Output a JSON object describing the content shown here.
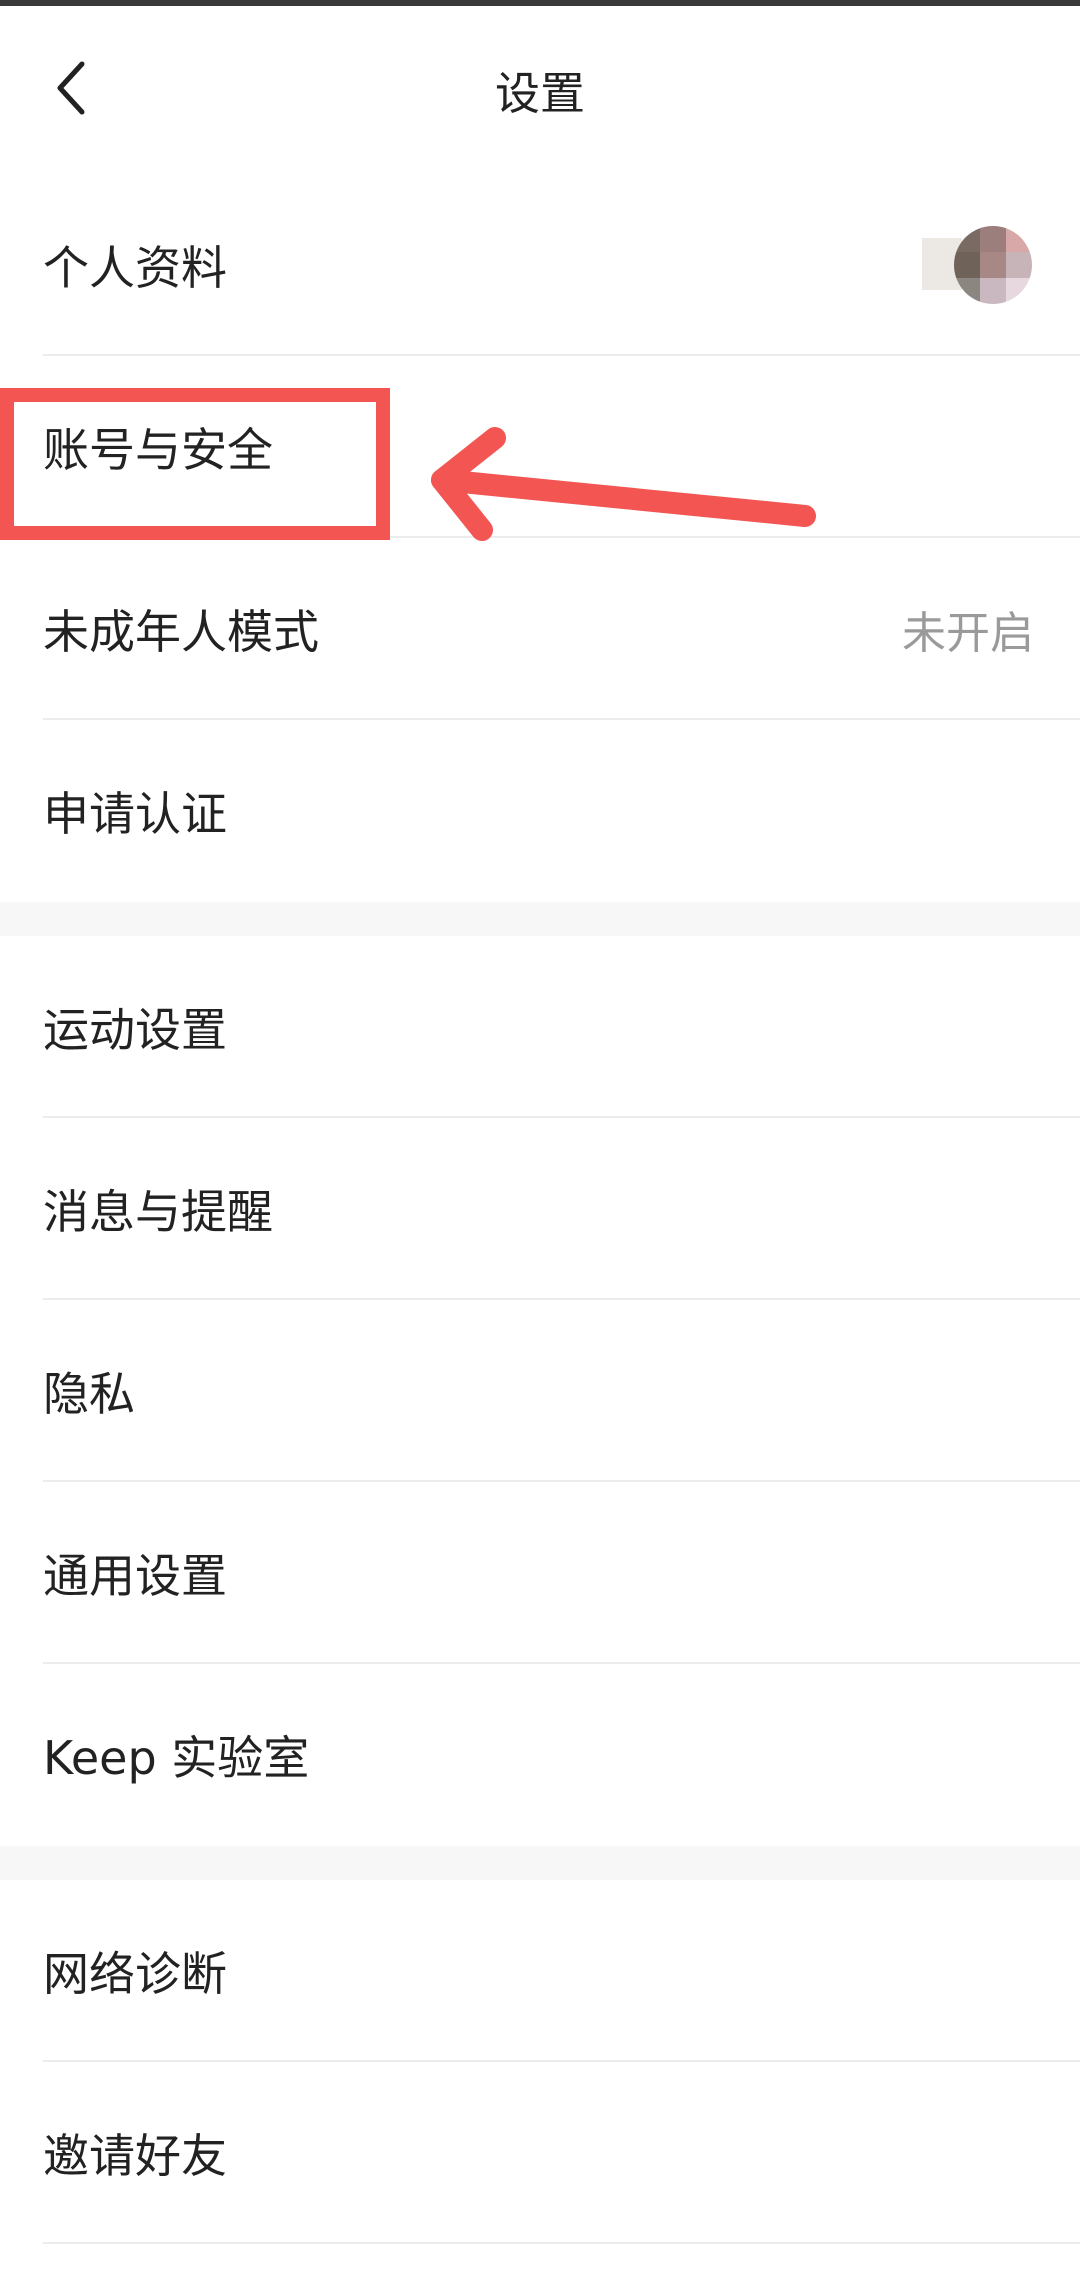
{
  "header": {
    "title": "设置",
    "back_icon": "chevron-left-icon"
  },
  "sections": [
    {
      "items": [
        {
          "label": "个人资料",
          "value": "",
          "trailing": "avatar"
        },
        {
          "label": "账号与安全",
          "value": ""
        },
        {
          "label": "未成年人模式",
          "value": "未开启"
        },
        {
          "label": "申请认证",
          "value": ""
        }
      ]
    },
    {
      "items": [
        {
          "label": "运动设置",
          "value": ""
        },
        {
          "label": "消息与提醒",
          "value": ""
        },
        {
          "label": "隐私",
          "value": ""
        },
        {
          "label": "通用设置",
          "value": ""
        },
        {
          "label": "Keep 实验室",
          "value": ""
        }
      ]
    },
    {
      "items": [
        {
          "label": "网络诊断",
          "value": ""
        },
        {
          "label": "邀请好友",
          "value": ""
        }
      ]
    }
  ],
  "colors": {
    "annotation": "#f25552",
    "divider": "#ececec",
    "secondary_text": "#9a9a9a"
  }
}
